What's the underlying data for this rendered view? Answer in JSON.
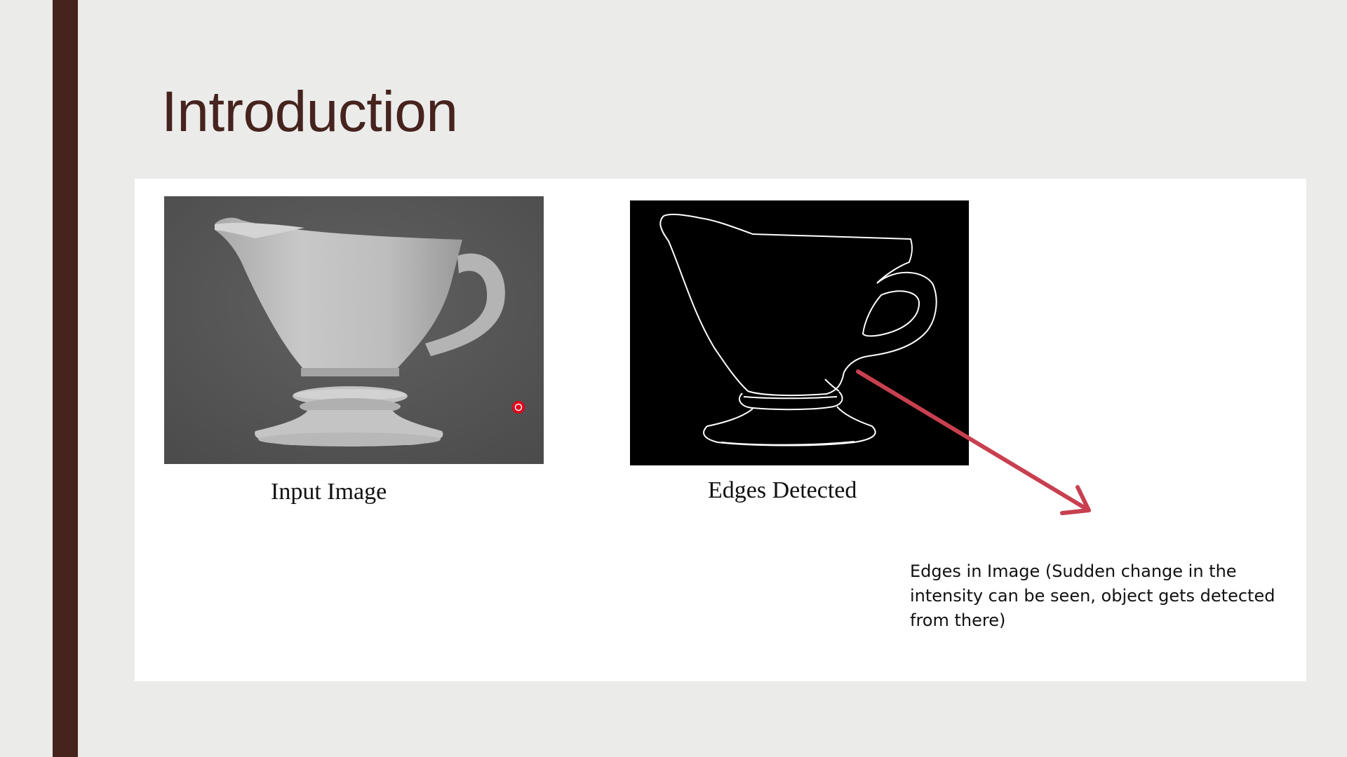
{
  "slide": {
    "title": "Introduction",
    "accent_color": "#46231d",
    "background_color": "#ebebea"
  },
  "figures": {
    "input_caption": "Input Image",
    "edges_caption": "Edges Detected",
    "annotation_text": "Edges in Image (Sudden change in the intensity can be seen, object gets detected from there)",
    "arrow_color": "#c8404f"
  },
  "icons": {
    "laser_pointer": "laser-pointer-dot-icon"
  }
}
